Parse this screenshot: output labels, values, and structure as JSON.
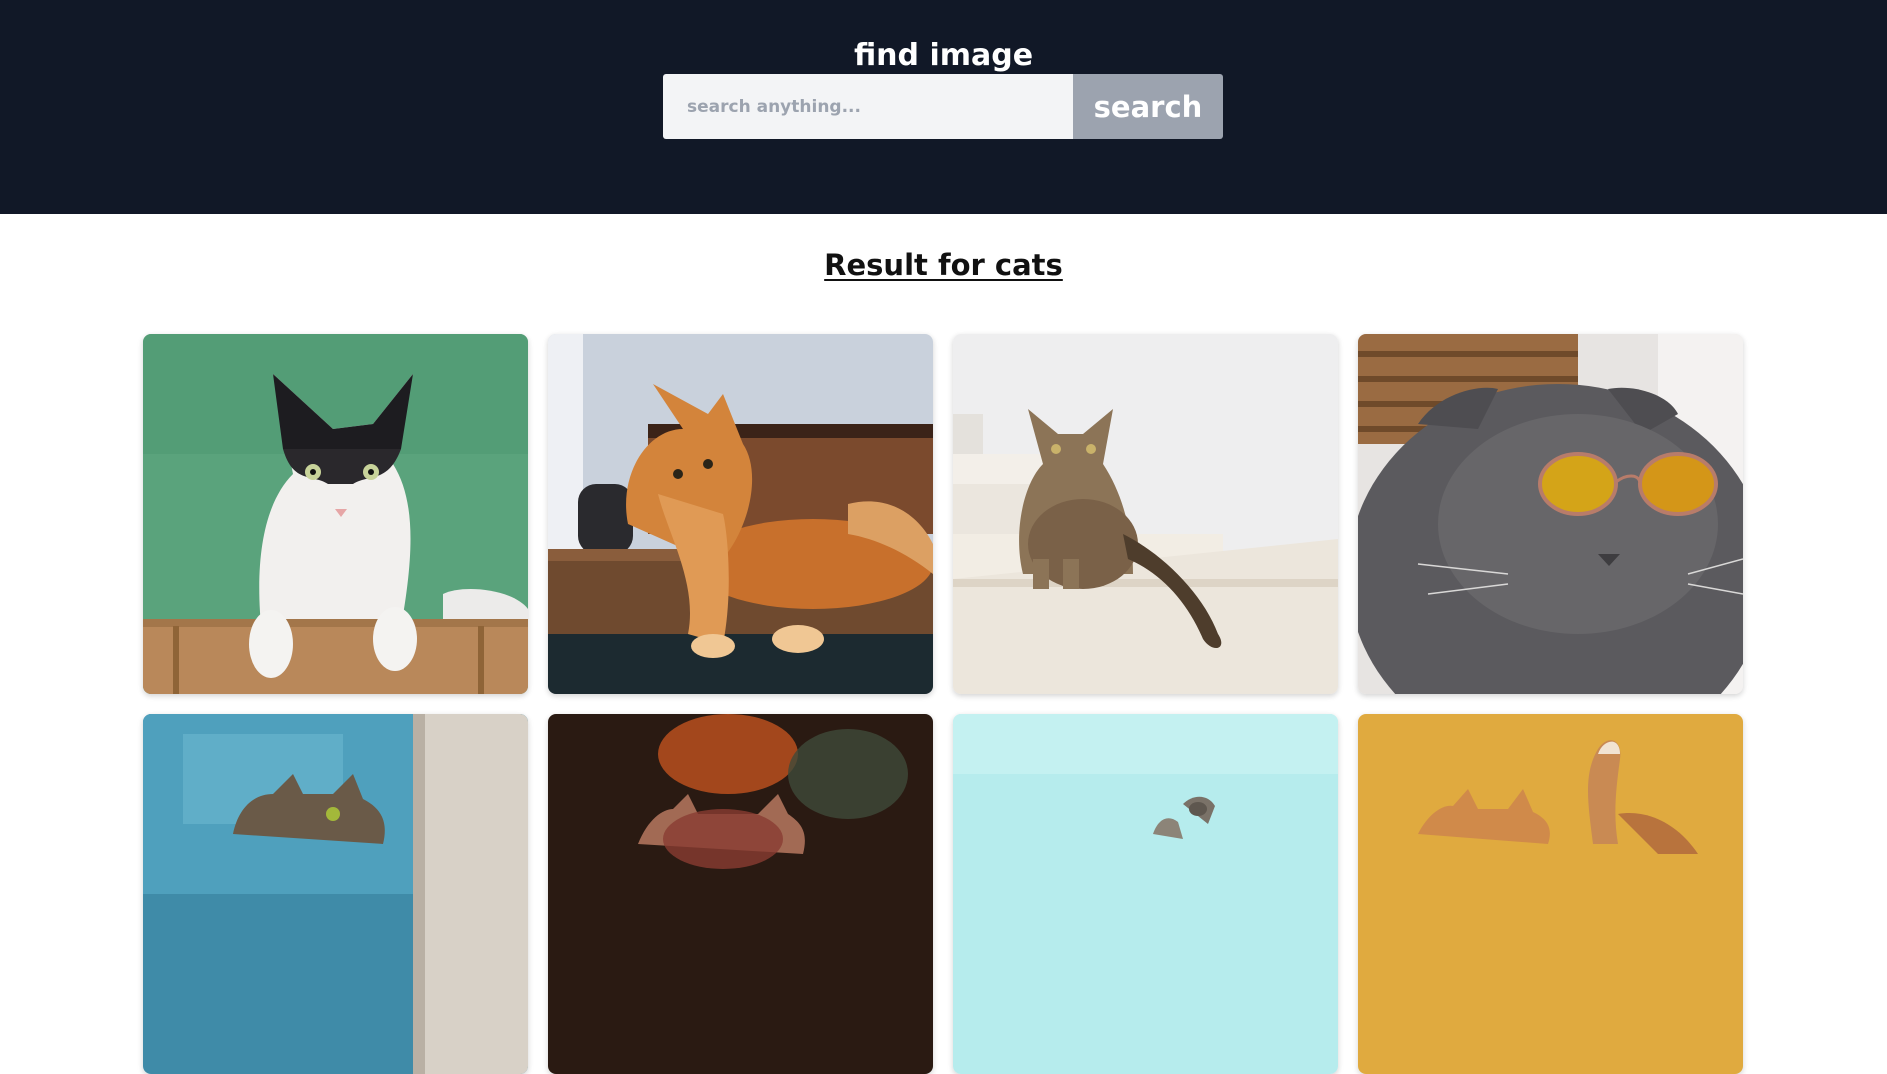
{
  "header": {
    "title": "find image",
    "search_placeholder": "search anything...",
    "search_value": "",
    "search_button_label": "search",
    "background_color": "#111827"
  },
  "results": {
    "heading": "Result for cats",
    "images": [
      {
        "subject": "black and white cat on green background",
        "name": "cat-photo"
      },
      {
        "subject": "orange long-haired cat lying on table",
        "name": "cat-photo"
      },
      {
        "subject": "tabby cat sitting on white stairs",
        "name": "cat-photo"
      },
      {
        "subject": "grey cat wearing yellow sunglasses",
        "name": "cat-photo"
      },
      {
        "subject": "tabby cat peeking past blue wall",
        "name": "cat-photo"
      },
      {
        "subject": "cat in dark warm-lit room",
        "name": "cat-photo"
      },
      {
        "subject": "cat against light cyan background",
        "name": "cat-photo"
      },
      {
        "subject": "orange cat against yellow background",
        "name": "cat-photo"
      }
    ]
  }
}
